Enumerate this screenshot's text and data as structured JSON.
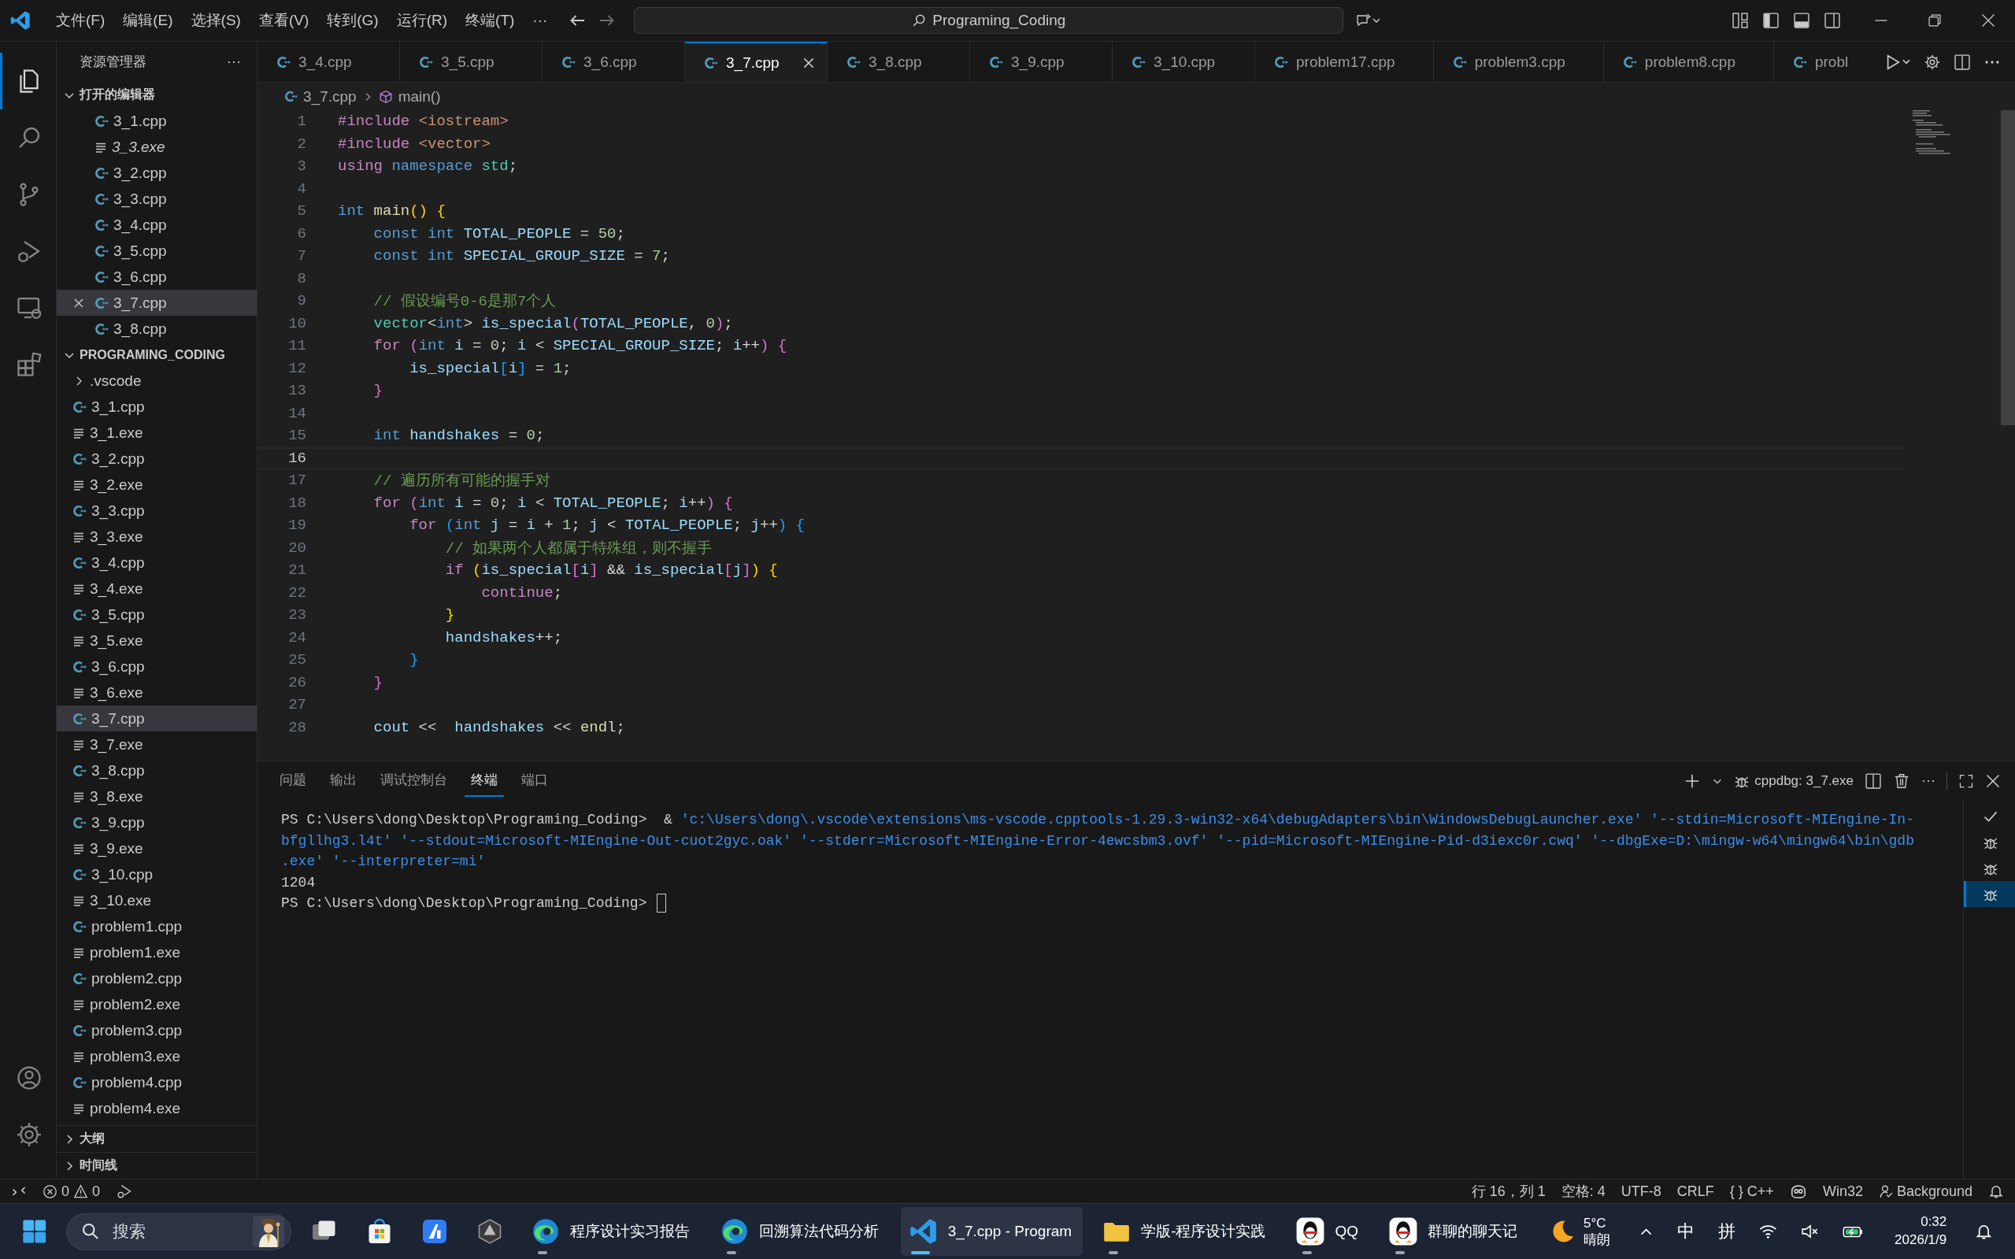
{
  "title_bar": {
    "menus": [
      "文件(F)",
      "编辑(E)",
      "选择(S)",
      "查看(V)",
      "转到(G)",
      "运行(R)",
      "终端(T)"
    ],
    "more": "···",
    "command_center": "Programing_Coding"
  },
  "activity_bar": {
    "top": [
      {
        "kind": "explorer",
        "selected": true
      },
      {
        "kind": "search",
        "selected": false
      },
      {
        "kind": "scm",
        "selected": false
      },
      {
        "kind": "debug",
        "selected": false
      },
      {
        "kind": "remote",
        "selected": false
      },
      {
        "kind": "extensions",
        "selected": false
      }
    ],
    "bottom": [
      {
        "kind": "account",
        "selected": false
      },
      {
        "kind": "settings",
        "selected": false
      }
    ]
  },
  "sidebar": {
    "title": "资源管理器",
    "more": "···",
    "open_editors": {
      "title": "打开的编辑器",
      "expanded": true,
      "items": [
        {
          "name": "3_1.cpp",
          "kind": "cpp",
          "selected": false,
          "preview": false
        },
        {
          "name": "3_3.exe",
          "kind": "exe",
          "selected": false,
          "preview": true
        },
        {
          "name": "3_2.cpp",
          "kind": "cpp",
          "selected": false,
          "preview": false
        },
        {
          "name": "3_3.cpp",
          "kind": "cpp",
          "selected": false,
          "preview": false
        },
        {
          "name": "3_4.cpp",
          "kind": "cpp",
          "selected": false,
          "preview": false
        },
        {
          "name": "3_5.cpp",
          "kind": "cpp",
          "selected": false,
          "preview": false
        },
        {
          "name": "3_6.cpp",
          "kind": "cpp",
          "selected": false,
          "preview": false
        },
        {
          "name": "3_7.cpp",
          "kind": "cpp",
          "selected": true,
          "preview": false
        },
        {
          "name": "3_8.cpp",
          "kind": "cpp",
          "selected": false,
          "preview": false
        }
      ]
    },
    "folder": {
      "title": "PROGRAMING_CODING",
      "expanded": true,
      "items": [
        {
          "name": ".vscode",
          "kind": "folder",
          "selected": false
        },
        {
          "name": "3_1.cpp",
          "kind": "cpp",
          "selected": false
        },
        {
          "name": "3_1.exe",
          "kind": "exe",
          "selected": false
        },
        {
          "name": "3_2.cpp",
          "kind": "cpp",
          "selected": false
        },
        {
          "name": "3_2.exe",
          "kind": "exe",
          "selected": false
        },
        {
          "name": "3_3.cpp",
          "kind": "cpp",
          "selected": false
        },
        {
          "name": "3_3.exe",
          "kind": "exe",
          "selected": false
        },
        {
          "name": "3_4.cpp",
          "kind": "cpp",
          "selected": false
        },
        {
          "name": "3_4.exe",
          "kind": "exe",
          "selected": false
        },
        {
          "name": "3_5.cpp",
          "kind": "cpp",
          "selected": false
        },
        {
          "name": "3_5.exe",
          "kind": "exe",
          "selected": false
        },
        {
          "name": "3_6.cpp",
          "kind": "cpp",
          "selected": false
        },
        {
          "name": "3_6.exe",
          "kind": "exe",
          "selected": false
        },
        {
          "name": "3_7.cpp",
          "kind": "cpp",
          "selected": true
        },
        {
          "name": "3_7.exe",
          "kind": "exe",
          "selected": false
        },
        {
          "name": "3_8.cpp",
          "kind": "cpp",
          "selected": false
        },
        {
          "name": "3_8.exe",
          "kind": "exe",
          "selected": false
        },
        {
          "name": "3_9.cpp",
          "kind": "cpp",
          "selected": false
        },
        {
          "name": "3_9.exe",
          "kind": "exe",
          "selected": false
        },
        {
          "name": "3_10.cpp",
          "kind": "cpp",
          "selected": false
        },
        {
          "name": "3_10.exe",
          "kind": "exe",
          "selected": false
        },
        {
          "name": "problem1.cpp",
          "kind": "cpp",
          "selected": false
        },
        {
          "name": "problem1.exe",
          "kind": "exe",
          "selected": false
        },
        {
          "name": "problem2.cpp",
          "kind": "cpp",
          "selected": false
        },
        {
          "name": "problem2.exe",
          "kind": "exe",
          "selected": false
        },
        {
          "name": "problem3.cpp",
          "kind": "cpp",
          "selected": false
        },
        {
          "name": "problem3.exe",
          "kind": "exe",
          "selected": false
        },
        {
          "name": "problem4.cpp",
          "kind": "cpp",
          "selected": false
        },
        {
          "name": "problem4.exe",
          "kind": "exe",
          "selected": false
        }
      ]
    },
    "sections": [
      {
        "title": "大纲",
        "expanded": false
      },
      {
        "title": "时间线",
        "expanded": false
      }
    ]
  },
  "tabs": [
    {
      "label": "3_4.cpp",
      "selected": false
    },
    {
      "label": "3_5.cpp",
      "selected": false
    },
    {
      "label": "3_6.cpp",
      "selected": false
    },
    {
      "label": "3_7.cpp",
      "selected": true
    },
    {
      "label": "3_8.cpp",
      "selected": false
    },
    {
      "label": "3_9.cpp",
      "selected": false
    },
    {
      "label": "3_10.cpp",
      "selected": false
    },
    {
      "label": "problem17.cpp",
      "selected": false
    },
    {
      "label": "problem3.cpp",
      "selected": false
    },
    {
      "label": "problem8.cpp",
      "selected": false
    },
    {
      "label": "probl",
      "selected": false
    }
  ],
  "breadcrumb": {
    "file": "3_7.cpp",
    "symbol": "main()"
  },
  "code": [
    {
      "number": "1",
      "current": false,
      "tokens": [
        {
          "text": "#include ",
          "kind": "macro"
        },
        {
          "text": "<iostream>",
          "kind": "str"
        }
      ]
    },
    {
      "number": "2",
      "current": false,
      "tokens": [
        {
          "text": "#include ",
          "kind": "macro"
        },
        {
          "text": "<vector>",
          "kind": "str"
        }
      ]
    },
    {
      "number": "3",
      "current": false,
      "tokens": [
        {
          "text": "using ",
          "kind": "kw"
        },
        {
          "text": "namespace ",
          "kind": "type"
        },
        {
          "text": "std",
          "kind": "ns"
        },
        {
          "text": ";",
          "kind": "plain"
        }
      ]
    },
    {
      "number": "4",
      "current": false
    },
    {
      "number": "5",
      "current": false,
      "tokens": [
        {
          "text": "int ",
          "kind": "type"
        },
        {
          "text": "main",
          "kind": "fn"
        },
        {
          "text": "()",
          "kind": "b1"
        },
        {
          "text": " {",
          "kind": "b1"
        }
      ]
    },
    {
      "number": "6",
      "current": false,
      "tokens": [
        {
          "text": "    const int ",
          "kind": "type"
        },
        {
          "text": "TOTAL_PEOPLE",
          "kind": "var"
        },
        {
          "text": " = ",
          "kind": "plain"
        },
        {
          "text": "50",
          "kind": "num"
        },
        {
          "text": ";",
          "kind": "plain"
        }
      ]
    },
    {
      "number": "7",
      "current": false,
      "tokens": [
        {
          "text": "    const int ",
          "kind": "type"
        },
        {
          "text": "SPECIAL_GROUP_SIZE",
          "kind": "var"
        },
        {
          "text": " = ",
          "kind": "plain"
        },
        {
          "text": "7",
          "kind": "num"
        },
        {
          "text": ";",
          "kind": "plain"
        }
      ]
    },
    {
      "number": "8",
      "current": false
    },
    {
      "number": "9",
      "current": false,
      "tokens": [
        {
          "text": "    // 假设编号0-6是那7个人",
          "kind": "cm"
        }
      ]
    },
    {
      "number": "10",
      "current": false,
      "tokens": [
        {
          "text": "    vector",
          "kind": "ns"
        },
        {
          "text": "<",
          "kind": "plain"
        },
        {
          "text": "int",
          "kind": "type"
        },
        {
          "text": "> ",
          "kind": "plain"
        },
        {
          "text": "is_special",
          "kind": "var"
        },
        {
          "text": "(",
          "kind": "b2"
        },
        {
          "text": "TOTAL_PEOPLE",
          "kind": "var"
        },
        {
          "text": ", ",
          "kind": "plain"
        },
        {
          "text": "0",
          "kind": "num"
        },
        {
          "text": ")",
          "kind": "b2"
        },
        {
          "text": ";",
          "kind": "plain"
        }
      ]
    },
    {
      "number": "11",
      "current": false,
      "tokens": [
        {
          "text": "    for ",
          "kind": "kw"
        },
        {
          "text": "(",
          "kind": "b2"
        },
        {
          "text": "int ",
          "kind": "type"
        },
        {
          "text": "i",
          "kind": "var"
        },
        {
          "text": " = ",
          "kind": "plain"
        },
        {
          "text": "0",
          "kind": "num"
        },
        {
          "text": "; ",
          "kind": "plain"
        },
        {
          "text": "i",
          "kind": "var"
        },
        {
          "text": " < ",
          "kind": "plain"
        },
        {
          "text": "SPECIAL_GROUP_SIZE",
          "kind": "var"
        },
        {
          "text": "; ",
          "kind": "plain"
        },
        {
          "text": "i",
          "kind": "var"
        },
        {
          "text": "++",
          "kind": "plain"
        },
        {
          "text": ") {",
          "kind": "b2"
        }
      ]
    },
    {
      "number": "12",
      "current": false,
      "tokens": [
        {
          "text": "        is_special",
          "kind": "var"
        },
        {
          "text": "[",
          "kind": "b3"
        },
        {
          "text": "i",
          "kind": "var"
        },
        {
          "text": "]",
          "kind": "b3"
        },
        {
          "text": " = ",
          "kind": "plain"
        },
        {
          "text": "1",
          "kind": "num"
        },
        {
          "text": ";",
          "kind": "plain"
        }
      ]
    },
    {
      "number": "13",
      "current": false,
      "tokens": [
        {
          "text": "    }",
          "kind": "b2"
        }
      ]
    },
    {
      "number": "14",
      "current": false
    },
    {
      "number": "15",
      "current": false,
      "tokens": [
        {
          "text": "    int ",
          "kind": "type"
        },
        {
          "text": "handshakes",
          "kind": "var"
        },
        {
          "text": " = ",
          "kind": "plain"
        },
        {
          "text": "0",
          "kind": "num"
        },
        {
          "text": ";",
          "kind": "plain"
        }
      ]
    },
    {
      "number": "16",
      "current": true
    },
    {
      "number": "17",
      "current": false,
      "tokens": [
        {
          "text": "    // 遍历所有可能的握手对",
          "kind": "cm"
        }
      ]
    },
    {
      "number": "18",
      "current": false,
      "tokens": [
        {
          "text": "    for ",
          "kind": "kw"
        },
        {
          "text": "(",
          "kind": "b2"
        },
        {
          "text": "int ",
          "kind": "type"
        },
        {
          "text": "i",
          "kind": "var"
        },
        {
          "text": " = ",
          "kind": "plain"
        },
        {
          "text": "0",
          "kind": "num"
        },
        {
          "text": "; ",
          "kind": "plain"
        },
        {
          "text": "i",
          "kind": "var"
        },
        {
          "text": " < ",
          "kind": "plain"
        },
        {
          "text": "TOTAL_PEOPLE",
          "kind": "var"
        },
        {
          "text": "; ",
          "kind": "plain"
        },
        {
          "text": "i",
          "kind": "var"
        },
        {
          "text": "++",
          "kind": "plain"
        },
        {
          "text": ") {",
          "kind": "b2"
        }
      ]
    },
    {
      "number": "19",
      "current": false,
      "tokens": [
        {
          "text": "        for ",
          "kind": "kw"
        },
        {
          "text": "(",
          "kind": "b3"
        },
        {
          "text": "int ",
          "kind": "type"
        },
        {
          "text": "j",
          "kind": "var"
        },
        {
          "text": " = ",
          "kind": "plain"
        },
        {
          "text": "i",
          "kind": "var"
        },
        {
          "text": " + ",
          "kind": "plain"
        },
        {
          "text": "1",
          "kind": "num"
        },
        {
          "text": "; ",
          "kind": "plain"
        },
        {
          "text": "j",
          "kind": "var"
        },
        {
          "text": " < ",
          "kind": "plain"
        },
        {
          "text": "TOTAL_PEOPLE",
          "kind": "var"
        },
        {
          "text": "; ",
          "kind": "plain"
        },
        {
          "text": "j",
          "kind": "var"
        },
        {
          "text": "++",
          "kind": "plain"
        },
        {
          "text": ") {",
          "kind": "b3"
        }
      ]
    },
    {
      "number": "20",
      "current": false,
      "tokens": [
        {
          "text": "            // 如果两个人都属于特殊组，则不握手",
          "kind": "cm"
        }
      ]
    },
    {
      "number": "21",
      "current": false,
      "tokens": [
        {
          "text": "            if ",
          "kind": "kw"
        },
        {
          "text": "(",
          "kind": "b1"
        },
        {
          "text": "is_special",
          "kind": "var"
        },
        {
          "text": "[",
          "kind": "b2"
        },
        {
          "text": "i",
          "kind": "var"
        },
        {
          "text": "]",
          "kind": "b2"
        },
        {
          "text": " && ",
          "kind": "plain"
        },
        {
          "text": "is_special",
          "kind": "var"
        },
        {
          "text": "[",
          "kind": "b2"
        },
        {
          "text": "j",
          "kind": "var"
        },
        {
          "text": "]",
          "kind": "b2"
        },
        {
          "text": ") {",
          "kind": "b1"
        }
      ]
    },
    {
      "number": "22",
      "current": false,
      "tokens": [
        {
          "text": "                continue",
          "kind": "kw"
        },
        {
          "text": ";",
          "kind": "plain"
        }
      ]
    },
    {
      "number": "23",
      "current": false,
      "tokens": [
        {
          "text": "            }",
          "kind": "b1"
        }
      ]
    },
    {
      "number": "24",
      "current": false,
      "tokens": [
        {
          "text": "            handshakes",
          "kind": "var"
        },
        {
          "text": "++;",
          "kind": "plain"
        }
      ]
    },
    {
      "number": "25",
      "current": false,
      "tokens": [
        {
          "text": "        }",
          "kind": "b3"
        }
      ]
    },
    {
      "number": "26",
      "current": false,
      "tokens": [
        {
          "text": "    }",
          "kind": "b2"
        }
      ]
    },
    {
      "number": "27",
      "current": false
    },
    {
      "number": "28",
      "current": false,
      "tokens": [
        {
          "text": "    cout",
          "kind": "var"
        },
        {
          "text": " <<  ",
          "kind": "plain"
        },
        {
          "text": "handshakes",
          "kind": "var"
        },
        {
          "text": " << ",
          "kind": "plain"
        },
        {
          "text": "endl",
          "kind": "fn"
        },
        {
          "text": ";",
          "kind": "plain"
        }
      ]
    }
  ],
  "panel": {
    "tabs": [
      {
        "label": "问题",
        "selected": false
      },
      {
        "label": "输出",
        "selected": false
      },
      {
        "label": "调试控制台",
        "selected": false
      },
      {
        "label": "终端",
        "selected": true
      },
      {
        "label": "端口",
        "selected": false
      }
    ],
    "terminal_name": "cppdbg: 3_7.exe",
    "more": "···",
    "lines": [
      [
        {
          "text": "PS C:\\Users\\dong\\Desktop\\Programing_Coding>  & ",
          "kind": "plain"
        },
        {
          "text": "'c:\\Users\\dong\\.vscode\\extensions\\ms-vscode.cpptools-1.29.3-win32-x64\\debugAdapters\\bin\\WindowsDebugLauncher.exe' '--stdin=Microsoft-MIEngine-In-",
          "kind": "str"
        }
      ],
      [
        {
          "text": "bfgllhg3.l4t' '--stdout=Microsoft-MIEngine-Out-cuot2gyc.oak' '--stderr=Microsoft-MIEngine-Error-4ewcsbm3.ovf' '--pid=Microsoft-MIEngine-Pid-d3iexc0r.cwq' '--dbgExe=D:\\mingw-w64\\mingw64\\bin\\gdb",
          "kind": "str"
        }
      ],
      [
        {
          "text": ".exe' '--interpreter=mi'",
          "kind": "str"
        }
      ],
      [
        {
          "text": "1204",
          "kind": "plain"
        }
      ],
      [
        {
          "text": "PS C:\\Users\\dong\\Desktop\\Programing_Coding> ",
          "kind": "plain"
        }
      ]
    ],
    "sessions": [
      {
        "kind": "check",
        "selected": false
      },
      {
        "kind": "debug",
        "selected": false
      },
      {
        "kind": "debug",
        "selected": false
      },
      {
        "kind": "debug",
        "selected": true
      }
    ]
  },
  "status_bar": {
    "errors": "0",
    "warnings": "0",
    "position": "行 16，列 1",
    "indent": "空格: 4",
    "encoding": "UTF-8",
    "eol": "CRLF",
    "language_icon": "{ }",
    "language": "C++",
    "platform": "Win32",
    "background": "Background"
  },
  "taskbar": {
    "search": {
      "placeholder": "搜索"
    },
    "apps": [
      {
        "kind": "task-view",
        "running": false,
        "selected": false
      },
      {
        "kind": "store",
        "running": false,
        "selected": false
      },
      {
        "kind": "app",
        "running": false,
        "selected": false
      },
      {
        "kind": "gem",
        "running": false,
        "selected": false
      },
      {
        "kind": "edge",
        "label": "程序设计实习报告",
        "running": true,
        "selected": false
      },
      {
        "kind": "edge",
        "label": "回溯算法代码分析",
        "running": true,
        "selected": false
      },
      {
        "kind": "vscode",
        "label": "3_7.cpp - Program",
        "running": true,
        "selected": true
      },
      {
        "kind": "folder",
        "label": "学版-程序设计实践",
        "running": true,
        "selected": false
      },
      {
        "kind": "qq",
        "label": "QQ",
        "running": true,
        "selected": false
      },
      {
        "kind": "qq",
        "label": "群聊的聊天记",
        "running": true,
        "selected": false
      }
    ],
    "weather": {
      "temperature": "5°C",
      "condition": "晴朗"
    },
    "tray": {
      "ime_mode": "中",
      "ime": "拼"
    },
    "clock": {
      "time": "0:32",
      "date": "2026/1/9"
    }
  }
}
